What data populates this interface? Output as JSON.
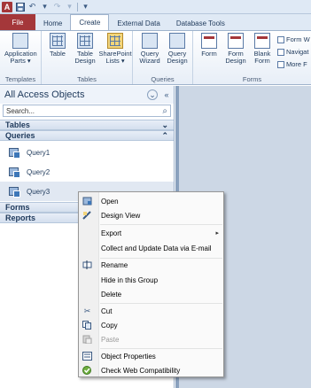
{
  "titlebar": {
    "app_letter": "A",
    "undo_glyph": "↶",
    "redo_glyph": "↷",
    "dropdown_glyph": "▾"
  },
  "ribbon_tabs": [
    "File",
    "Home",
    "Create",
    "External Data",
    "Database Tools"
  ],
  "ribbon": {
    "groups": {
      "templates": {
        "label": "Templates",
        "buttons": [
          {
            "label": "Application Parts ▾"
          }
        ]
      },
      "tables": {
        "label": "Tables",
        "buttons": [
          {
            "label": "Table"
          },
          {
            "label": "Table Design"
          },
          {
            "label": "SharePoint Lists ▾"
          }
        ]
      },
      "queries": {
        "label": "Queries",
        "buttons": [
          {
            "label": "Query Wizard"
          },
          {
            "label": "Query Design"
          }
        ]
      },
      "forms": {
        "label": "Forms",
        "buttons": [
          {
            "label": "Form"
          },
          {
            "label": "Form Design"
          },
          {
            "label": "Blank Form"
          }
        ]
      }
    },
    "form_small_buttons": [
      "Form W",
      "Navigat",
      "More F"
    ]
  },
  "nav_pane": {
    "title": "All Access Objects",
    "search_placeholder": "Search...",
    "search_icon": "⌕",
    "groups": {
      "tables": {
        "label": "Tables",
        "toggle": "⌄"
      },
      "queries": {
        "label": "Queries",
        "toggle": "⌃",
        "items": [
          "Query1",
          "Query2",
          "Query3"
        ]
      },
      "forms": {
        "label": "Forms"
      },
      "reports": {
        "label": "Reports"
      }
    }
  },
  "context_menu": {
    "items": [
      {
        "label": "Open",
        "icon": "open-icon",
        "disabled": false
      },
      {
        "label": "Design View",
        "icon": "design-view-icon",
        "disabled": false
      },
      {
        "label": "Export",
        "icon": "",
        "disabled": false,
        "submenu_arrow": "▸"
      },
      {
        "label": "Collect and Update Data via E-mail",
        "icon": "",
        "disabled": false
      },
      {
        "label": "Rename",
        "icon": "rename-icon",
        "disabled": false
      },
      {
        "label": "Hide in this Group",
        "icon": "",
        "disabled": false
      },
      {
        "label": "Delete",
        "icon": "",
        "disabled": false
      },
      {
        "label": "Cut",
        "icon": "cut-icon",
        "disabled": false
      },
      {
        "label": "Copy",
        "icon": "copy-icon",
        "disabled": false
      },
      {
        "label": "Paste",
        "icon": "paste-icon",
        "disabled": true
      },
      {
        "label": "Object Properties",
        "icon": "properties-icon",
        "disabled": false
      },
      {
        "label": "Check Web Compatibility",
        "icon": "web-check-icon",
        "disabled": false
      }
    ]
  }
}
